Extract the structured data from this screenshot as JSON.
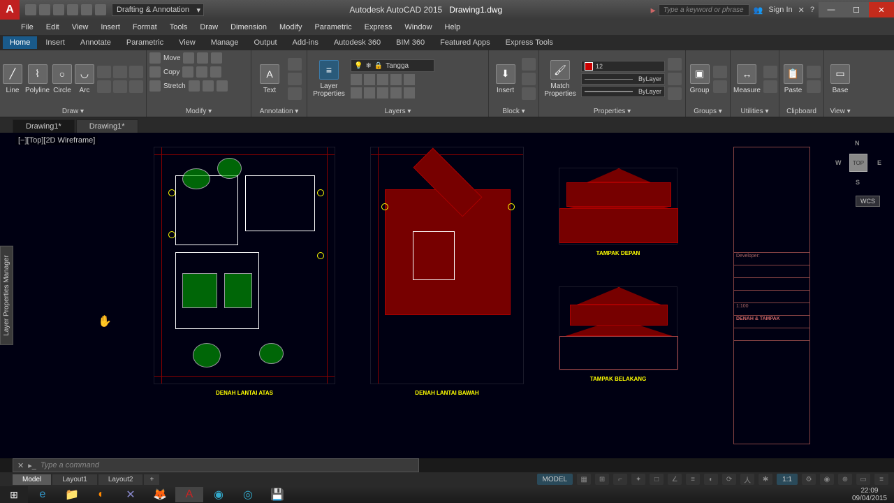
{
  "title": {
    "app": "Autodesk AutoCAD 2015",
    "file": "Drawing1.dwg"
  },
  "workspace": "Drafting & Annotation",
  "search_placeholder": "Type a keyword or phrase",
  "signin": "Sign In",
  "menus": [
    "File",
    "Edit",
    "View",
    "Insert",
    "Format",
    "Tools",
    "Draw",
    "Dimension",
    "Modify",
    "Parametric",
    "Express",
    "Window",
    "Help"
  ],
  "ribbon_tabs": [
    "Home",
    "Insert",
    "Annotate",
    "Parametric",
    "View",
    "Manage",
    "Output",
    "Add-ins",
    "Autodesk 360",
    "BIM 360",
    "Featured Apps",
    "Express Tools"
  ],
  "ribbon_active": "Home",
  "panels": {
    "draw": {
      "title": "Draw ▾",
      "btns": [
        "Line",
        "Polyline",
        "Circle",
        "Arc"
      ]
    },
    "modify": {
      "title": "Modify ▾",
      "rows": [
        "Move",
        "Copy",
        "Stretch"
      ]
    },
    "annotation": {
      "title": "Annotation ▾",
      "btn": "Text"
    },
    "layers": {
      "title": "Layers ▾",
      "btn": "Layer Properties",
      "current": "Tangga"
    },
    "block": {
      "title": "Block ▾",
      "btn": "Insert"
    },
    "properties": {
      "title": "Properties ▾",
      "btn": "Match Properties",
      "color": "12",
      "ltype": "ByLayer",
      "lweight": "ByLayer"
    },
    "groups": {
      "title": "Groups ▾",
      "btn": "Group"
    },
    "utilities": {
      "title": "Utilities ▾",
      "btn": "Measure"
    },
    "clipboard": {
      "title": "Clipboard",
      "btn": "Paste"
    },
    "view": {
      "title": "View ▾",
      "btn": "Base"
    }
  },
  "doc_tabs": [
    "Drawing1*",
    "Drawing1*"
  ],
  "viewport_label": "[−][Top][2D Wireframe]",
  "side_panel": "Layer Properties Manager",
  "viewcube": {
    "face": "TOP",
    "n": "N",
    "s": "S",
    "e": "E",
    "w": "W"
  },
  "wcs": "WCS",
  "drawing_labels": {
    "fp1": "DENAH LANTAI ATAS",
    "fp2": "DENAH LANTAI BAWAH",
    "elev1": "TAMPAK DEPAN",
    "elev2": "TAMPAK BELAKANG",
    "tb": "DENAH & TAMPAK",
    "scale": "1:100",
    "dev": "Developer:"
  },
  "command_placeholder": "Type a command",
  "layout_tabs": [
    "Model",
    "Layout1",
    "Layout2"
  ],
  "status_mode": "MODEL",
  "status_scale": "1:1",
  "clock": {
    "time": "22:09",
    "date": "09/04/2015"
  }
}
